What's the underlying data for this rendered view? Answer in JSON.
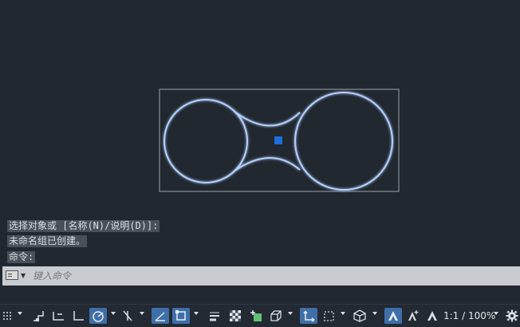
{
  "command_history": [
    "选择对象或 [名称(N)/说明(D)]:",
    "未命名组已创建。",
    "命令:"
  ],
  "command_line": {
    "placeholder": "键入命令"
  },
  "status_bar": {
    "icons": [
      "grid-icon",
      "snap-icon",
      "infer-constraints-icon",
      "ortho-icon",
      "polar-tracking-icon",
      "isodraft-icon",
      "object-snap-tracking-icon",
      "object-snap-icon",
      "lineweight-icon",
      "transparency-icon",
      "selection-cycling-icon",
      "3d-object-snap-icon",
      "dynamic-ucs-icon",
      "selection-filter-icon",
      "gizmo-icon",
      "annotation-visibility-icon",
      "auto-scale-icon",
      "annotation-scale-icon",
      "settings-icon"
    ],
    "annotation_scale": "1:1 / 100%"
  },
  "colors": {
    "background": "#212830",
    "geometry": "#a8c8ff",
    "selection_box": "#9aa3ad",
    "grip": "#1e6fd9"
  }
}
